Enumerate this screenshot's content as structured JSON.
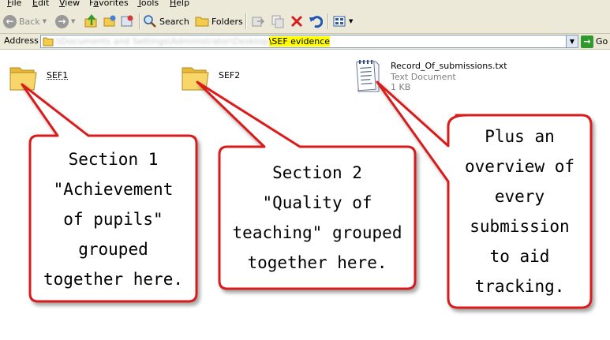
{
  "menu": [
    {
      "id": "file",
      "ul": "F",
      "rest": "ile"
    },
    {
      "id": "edit",
      "ul": "E",
      "rest": "dit"
    },
    {
      "id": "view",
      "ul": "V",
      "rest": "iew"
    },
    {
      "id": "favorites",
      "ul": "F",
      "rest": "a",
      "rest2": "vorites"
    },
    {
      "id": "tools",
      "ul": "T",
      "rest": "ools"
    },
    {
      "id": "help",
      "ul": "H",
      "rest": "elp"
    }
  ],
  "toolbar": {
    "back_label": "Back",
    "search_label": "Search",
    "folders_label": "Folders"
  },
  "address": {
    "label": "Address",
    "blurred_path": "\\\\Documents and Settings\\Administrator\\Desktop",
    "highlighted": "\\SEF evidence",
    "go_label": "Go"
  },
  "files": {
    "sef1": "SEF1",
    "sef2": "SEF2",
    "record_name": "Record_Of_submissions.txt",
    "record_type": "Text Document",
    "record_size": "1 KB"
  },
  "callouts": {
    "one": [
      "Section 1",
      "\"Achievement",
      "of pupils\"",
      "grouped",
      "together here."
    ],
    "two": [
      "Section 2",
      "\"Quality of",
      "teaching\" grouped",
      "together here."
    ],
    "three": [
      "Plus an",
      "overview of",
      "every",
      "submission",
      "to aid",
      "tracking."
    ]
  },
  "colors": {
    "callout_border": "#d81f1f",
    "highlight": "#ffff00",
    "chrome": "#ece9d8"
  },
  "icons": {
    "back": "back-arrow-icon",
    "forward": "forward-arrow-icon",
    "up": "up-folder-icon",
    "search": "search-icon",
    "folders": "folders-icon",
    "delete": "delete-icon",
    "undo": "undo-icon",
    "views": "views-icon",
    "go": "go-arrow-icon"
  }
}
